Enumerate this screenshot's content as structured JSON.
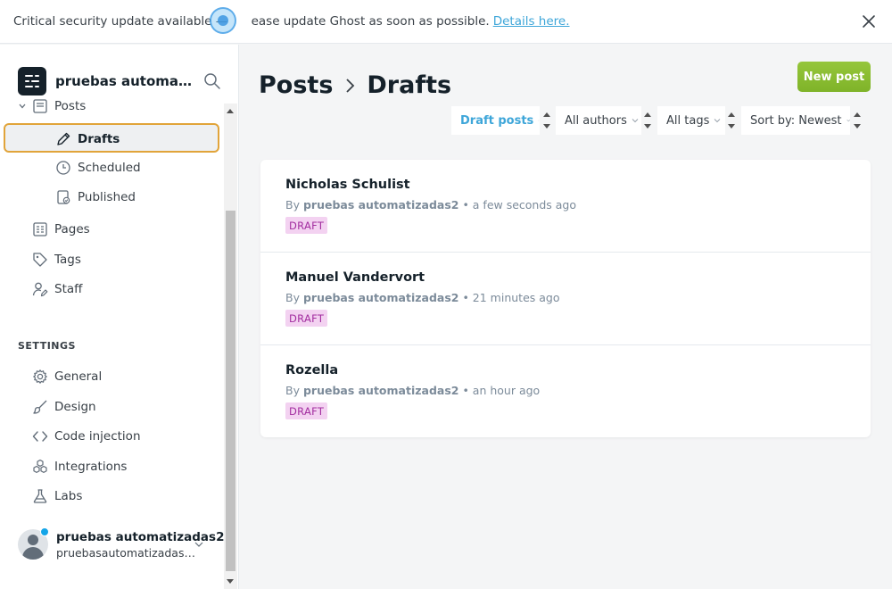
{
  "banner": {
    "text_before": "Critical security update available — ",
    "text_after": "ease update Ghost as soon as possible.",
    "link_label": "Details here."
  },
  "site": {
    "name": "pruebas automatiz..."
  },
  "nav": {
    "posts": "Posts",
    "drafts": "Drafts",
    "scheduled": "Scheduled",
    "published": "Published",
    "pages": "Pages",
    "tags": "Tags",
    "staff": "Staff",
    "settings_header": "SETTINGS",
    "general": "General",
    "design": "Design",
    "code_injection": "Code injection",
    "integrations": "Integrations",
    "labs": "Labs"
  },
  "user": {
    "name": "pruebas automatizadas2",
    "email": "pruebasautomatizadas@u..."
  },
  "header": {
    "crumb_root": "Posts",
    "crumb_current": "Drafts",
    "new_post_label": "New post"
  },
  "filters": {
    "type": "Draft posts",
    "author": "All authors",
    "tag": "All tags",
    "sort": "Sort by: Newest"
  },
  "posts": [
    {
      "title": "Nicholas Schulist",
      "by": "By ",
      "author": "pruebas automatizadas2",
      "time": " • a few seconds ago",
      "status": "DRAFT"
    },
    {
      "title": "Manuel Vandervort",
      "by": "By ",
      "author": "pruebas automatizadas2",
      "time": " • 21 minutes ago",
      "status": "DRAFT"
    },
    {
      "title": "Rozella",
      "by": "By ",
      "author": "pruebas automatizadas2",
      "time": " • an hour ago",
      "status": "DRAFT"
    }
  ],
  "colors": {
    "accent": "#3ea6d9",
    "primary_button": "#8bbd32",
    "active_outline": "#e1a43a",
    "draft_badge_bg": "#f3d2f1",
    "draft_badge_text": "#a32ea0"
  }
}
